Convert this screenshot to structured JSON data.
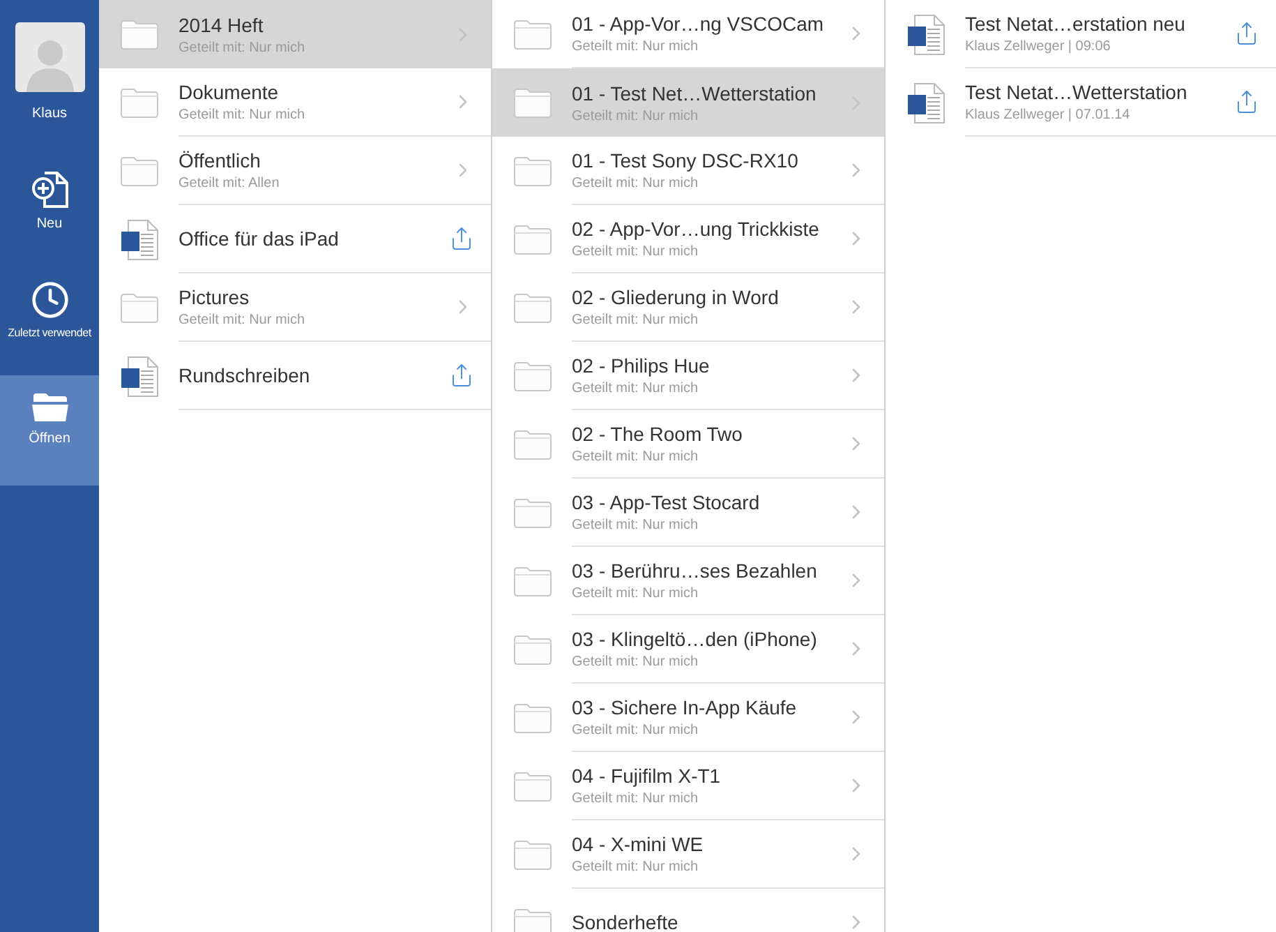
{
  "sidebar": {
    "user": {
      "name": "Klaus"
    },
    "items": [
      {
        "kind": "new",
        "label": "Neu",
        "selected": false
      },
      {
        "kind": "recent",
        "label": "Zuletzt verwendet",
        "selected": false
      },
      {
        "kind": "open",
        "label": "Öffnen",
        "selected": true
      }
    ]
  },
  "columns": [
    {
      "items": [
        {
          "kind": "folder",
          "title": "2014 Heft",
          "subtitle": "Geteilt mit: Nur mich",
          "selected": true
        },
        {
          "kind": "folder",
          "title": "Dokumente",
          "subtitle": "Geteilt mit: Nur mich",
          "selected": false
        },
        {
          "kind": "folder",
          "title": "Öffentlich",
          "subtitle": "Geteilt mit: Allen",
          "selected": false
        },
        {
          "kind": "document",
          "title": "Office für das iPad",
          "selected": false
        },
        {
          "kind": "folder",
          "title": "Pictures",
          "subtitle": "Geteilt mit: Nur mich",
          "selected": false
        },
        {
          "kind": "document",
          "title": "Rundschreiben",
          "selected": false
        }
      ]
    },
    {
      "items": [
        {
          "kind": "folder",
          "title": "01 - App-Vor…ng VSCOCam",
          "subtitle": "Geteilt mit: Nur mich",
          "selected": false
        },
        {
          "kind": "folder",
          "title": "01 - Test Net…Wetterstation",
          "subtitle": "Geteilt mit: Nur mich",
          "selected": true
        },
        {
          "kind": "folder",
          "title": "01 - Test Sony DSC-RX10",
          "subtitle": "Geteilt mit: Nur mich",
          "selected": false
        },
        {
          "kind": "folder",
          "title": "02 - App-Vor…ung Trickkiste",
          "subtitle": "Geteilt mit: Nur mich",
          "selected": false
        },
        {
          "kind": "folder",
          "title": "02 - Gliederung in Word",
          "subtitle": "Geteilt mit: Nur mich",
          "selected": false
        },
        {
          "kind": "folder",
          "title": "02 - Philips Hue",
          "subtitle": "Geteilt mit: Nur mich",
          "selected": false
        },
        {
          "kind": "folder",
          "title": "02 - The Room Two",
          "subtitle": "Geteilt mit: Nur mich",
          "selected": false
        },
        {
          "kind": "folder",
          "title": "03 - App-Test Stocard",
          "subtitle": "Geteilt mit: Nur mich",
          "selected": false
        },
        {
          "kind": "folder",
          "title": "03 - Berühru…ses Bezahlen",
          "subtitle": "Geteilt mit: Nur mich",
          "selected": false
        },
        {
          "kind": "folder",
          "title": "03 - Klingeltö…den (iPhone)",
          "subtitle": "Geteilt mit: Nur mich",
          "selected": false
        },
        {
          "kind": "folder",
          "title": "03 - Sichere In-App Käufe",
          "subtitle": "Geteilt mit: Nur mich",
          "selected": false
        },
        {
          "kind": "folder",
          "title": "04 - Fujifilm X-T1",
          "subtitle": "Geteilt mit: Nur mich",
          "selected": false
        },
        {
          "kind": "folder",
          "title": "04 - X-mini WE",
          "subtitle": "Geteilt mit: Nur mich",
          "selected": false
        },
        {
          "kind": "folder",
          "title": "Sonderhefte",
          "selected": false
        }
      ]
    },
    {
      "items": [
        {
          "kind": "document",
          "title": "Test Netat…erstation neu",
          "subtitle": "Klaus Zellweger | 09:06",
          "selected": false
        },
        {
          "kind": "document",
          "title": "Test Netat…Wetterstation",
          "subtitle": "Klaus Zellweger | 07.01.14",
          "selected": false
        }
      ]
    }
  ]
}
